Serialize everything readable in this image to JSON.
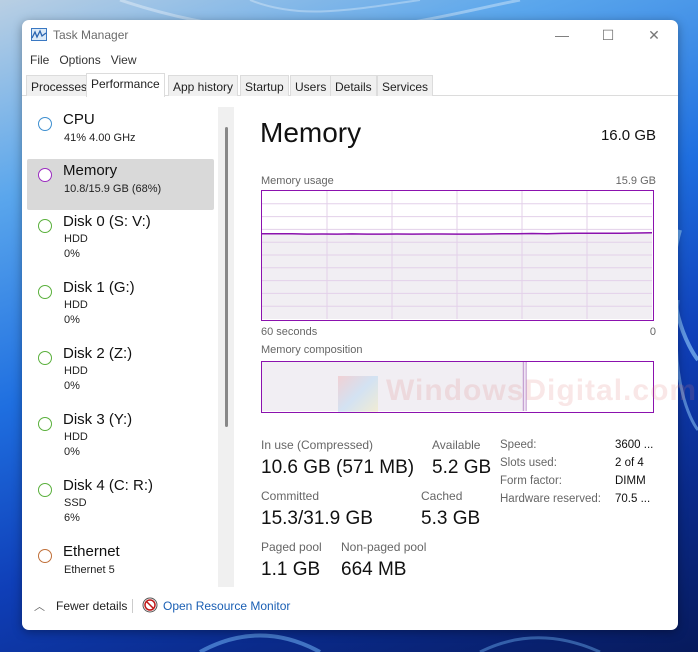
{
  "window": {
    "title": "Task Manager",
    "controls": {
      "minimize": "—",
      "maximize": "☐",
      "close": "✕"
    }
  },
  "menu": [
    "File",
    "Options",
    "View"
  ],
  "tabs": [
    {
      "label": "Processes",
      "active": false
    },
    {
      "label": "Performance",
      "active": true
    },
    {
      "label": "App history",
      "active": false
    },
    {
      "label": "Startup",
      "active": false
    },
    {
      "label": "Users",
      "active": false
    },
    {
      "label": "Details",
      "active": false
    },
    {
      "label": "Services",
      "active": false
    }
  ],
  "sidebar": {
    "items": [
      {
        "title": "CPU",
        "line1": "41% 4.00 GHz",
        "line2": "",
        "color": "#3e8fd0",
        "selected": false
      },
      {
        "title": "Memory",
        "line1": "10.8/15.9 GB (68%)",
        "line2": "",
        "color": "#9b2cc0",
        "selected": true
      },
      {
        "title": "Disk 0 (S: V:)",
        "line1": "HDD",
        "line2": "0%",
        "color": "#5ab03c",
        "selected": false
      },
      {
        "title": "Disk 1 (G:)",
        "line1": "HDD",
        "line2": "0%",
        "color": "#5ab03c",
        "selected": false
      },
      {
        "title": "Disk 2 (Z:)",
        "line1": "HDD",
        "line2": "0%",
        "color": "#5ab03c",
        "selected": false
      },
      {
        "title": "Disk 3 (Y:)",
        "line1": "HDD",
        "line2": "0%",
        "color": "#5ab03c",
        "selected": false
      },
      {
        "title": "Disk 4 (C: R:)",
        "line1": "SSD",
        "line2": "6%",
        "color": "#5ab03c",
        "selected": false
      },
      {
        "title": "Ethernet",
        "line1": "Ethernet 5",
        "line2": "",
        "color": "#c0703a",
        "selected": false
      }
    ]
  },
  "main": {
    "title": "Memory",
    "total": "16.0 GB",
    "usage_label": "Memory usage",
    "usage_max": "15.9 GB",
    "time_left": "60 seconds",
    "time_right": "0",
    "composition_label": "Memory composition",
    "stats": {
      "in_use_label": "In use (Compressed)",
      "in_use_value": "10.6 GB (571 MB)",
      "available_label": "Available",
      "available_value": "5.2 GB",
      "committed_label": "Committed",
      "committed_value": "15.3/31.9 GB",
      "cached_label": "Cached",
      "cached_value": "5.3 GB",
      "paged_label": "Paged pool",
      "paged_value": "1.1 GB",
      "nonpaged_label": "Non-paged pool",
      "nonpaged_value": "664 MB"
    },
    "details": [
      {
        "key": "Speed:",
        "value": "3600 ..."
      },
      {
        "key": "Slots used:",
        "value": "2 of 4"
      },
      {
        "key": "Form factor:",
        "value": "DIMM"
      },
      {
        "key": "Hardware reserved:",
        "value": "70.5 ..."
      }
    ]
  },
  "chart_data": {
    "type": "area",
    "title": "Memory usage",
    "xlabel": "60 seconds",
    "ylabel": "",
    "x_range": [
      60,
      0
    ],
    "ylim": [
      0,
      15.9
    ],
    "series": [
      {
        "name": "Memory in use (GB)",
        "color": "#8b12ae",
        "values": [
          10.6,
          10.6,
          10.58,
          10.55,
          10.56,
          10.55,
          10.57,
          10.55,
          10.55,
          10.56,
          10.55,
          10.56,
          10.56,
          10.55,
          10.55,
          10.56,
          10.58,
          10.6,
          10.62,
          10.6,
          10.63,
          10.65,
          10.66,
          10.66,
          10.66,
          10.68,
          10.72
        ]
      }
    ],
    "composition": {
      "in_use_fraction": 0.67,
      "modified_fraction": 0.005,
      "free_fraction": 0.325
    },
    "grid": true
  },
  "footer": {
    "fewer_details": "Fewer details",
    "resource_monitor": "Open Resource Monitor"
  },
  "watermark": "WindowsDigital.com",
  "colors": {
    "memory_accent": "#8b12ae",
    "link": "#1a5fb4",
    "selected_bg": "#d9d9d9"
  }
}
